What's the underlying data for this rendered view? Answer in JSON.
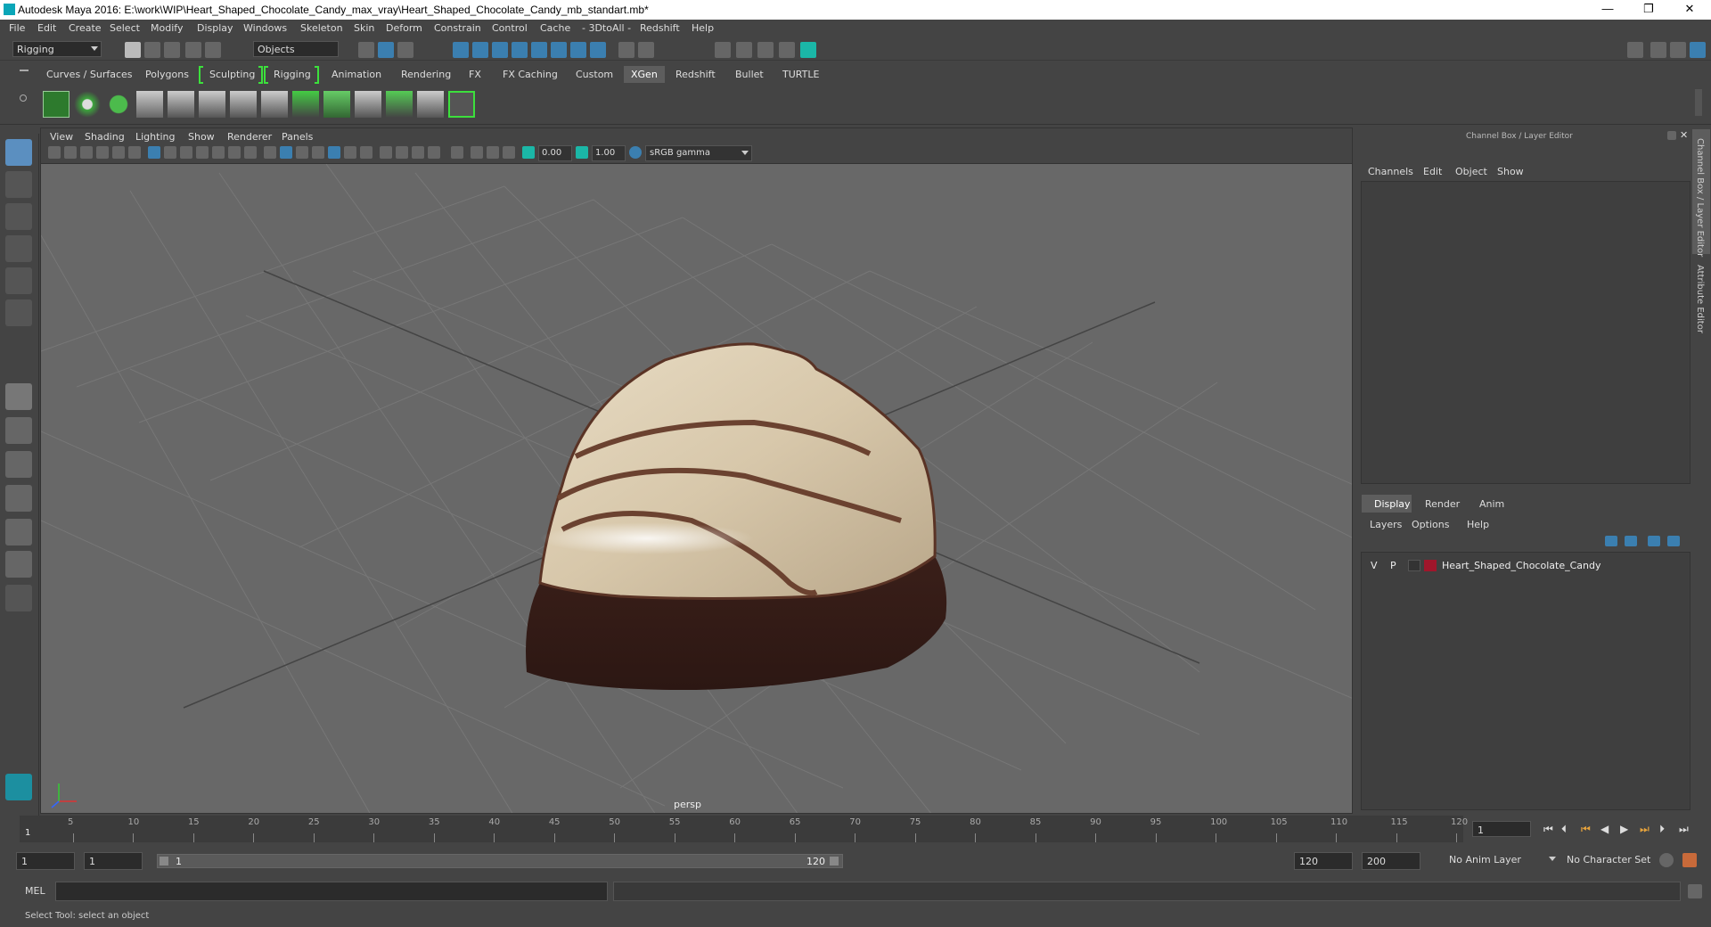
{
  "window": {
    "title": "Autodesk Maya 2016: E:\\work\\WIP\\Heart_Shaped_Chocolate_Candy_max_vray\\Heart_Shaped_Chocolate_Candy_mb_standart.mb*",
    "minimize": "—",
    "restore": "❐",
    "close": "✕"
  },
  "menubar": [
    "File",
    "Edit",
    "Create",
    "Select",
    "Modify",
    "Display",
    "Windows",
    "Skeleton",
    "Skin",
    "Deform",
    "Constrain",
    "Control",
    "Cache",
    "- 3DtoAll -",
    "Redshift",
    "Help"
  ],
  "statusline": {
    "menuset": "Rigging",
    "selection_mode": "Objects"
  },
  "shelf_tabs": [
    "Curves / Surfaces",
    "Polygons",
    "Sculpting",
    "Rigging",
    "Animation",
    "Rendering",
    "FX",
    "FX Caching",
    "Custom",
    "XGen",
    "Redshift",
    "Bullet",
    "TURTLE"
  ],
  "shelf_active": "XGen",
  "viewport": {
    "menus": [
      "View",
      "Shading",
      "Lighting",
      "Show",
      "Renderer",
      "Panels"
    ],
    "exposure": "0.00",
    "gamma": "1.00",
    "color_space": "sRGB gamma",
    "camera": "persp"
  },
  "right_panel": {
    "title": "Channel Box / Layer Editor",
    "channel_menus": [
      "Channels",
      "Edit",
      "Object",
      "Show"
    ],
    "layer_tabs": [
      "Display",
      "Render",
      "Anim"
    ],
    "layer_active": "Display",
    "layer_menus": [
      "Layers",
      "Options",
      "Help"
    ],
    "layers": [
      {
        "v": "V",
        "p": "P",
        "color": "#a0162b",
        "name": "Heart_Shaped_Chocolate_Candy"
      }
    ],
    "side_tabs": [
      "Channel Box / Layer Editor",
      "Attribute Editor"
    ]
  },
  "timeline": {
    "ticks": [
      "5",
      "10",
      "15",
      "20",
      "25",
      "30",
      "35",
      "40",
      "45",
      "50",
      "55",
      "60",
      "65",
      "70",
      "75",
      "80",
      "85",
      "90",
      "95",
      "100",
      "105",
      "110",
      "115",
      "120"
    ],
    "start_label": "1",
    "current_frame": "1"
  },
  "range": {
    "start": "1",
    "playback_start": "1",
    "slider_start": "1",
    "slider_end": "120",
    "playback_end": "120",
    "end": "200",
    "anim_layer": "No Anim Layer",
    "character_set": "No Character Set"
  },
  "mel": {
    "label": "MEL"
  },
  "help_line": "Select Tool: select an object"
}
